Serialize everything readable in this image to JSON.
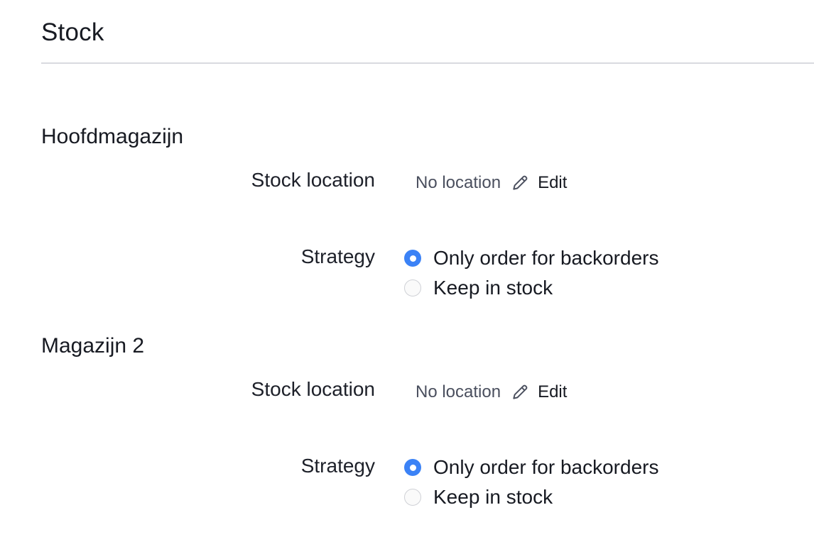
{
  "page": {
    "title": "Stock"
  },
  "warehouses": [
    {
      "name": "Hoofdmagazijn",
      "stock_location_label": "Stock location",
      "stock_location_value": "No location",
      "edit_label": "Edit",
      "strategy_label": "Strategy",
      "options": [
        {
          "label": "Only order for backorders",
          "selected": true
        },
        {
          "label": "Keep in stock",
          "selected": false
        }
      ]
    },
    {
      "name": "Magazijn 2",
      "stock_location_label": "Stock location",
      "stock_location_value": "No location",
      "edit_label": "Edit",
      "strategy_label": "Strategy",
      "options": [
        {
          "label": "Only order for backorders",
          "selected": true
        },
        {
          "label": "Keep in stock",
          "selected": false
        }
      ]
    }
  ],
  "colors": {
    "accent": "#3b82f6",
    "divider": "#d9dadf"
  }
}
